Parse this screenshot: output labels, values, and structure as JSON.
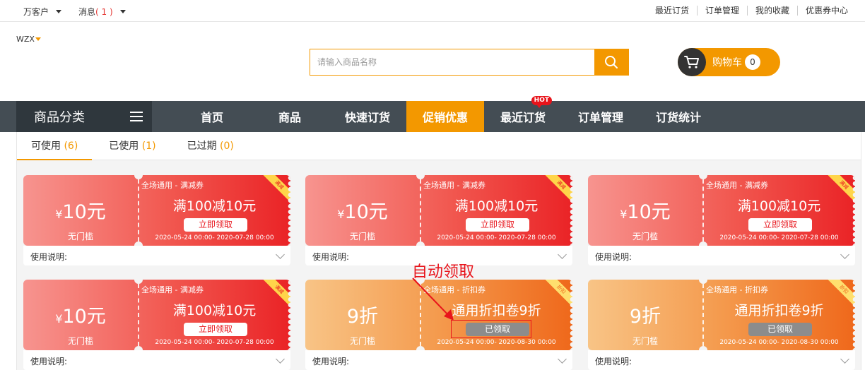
{
  "topbar": {
    "user": "万客户",
    "messages": "消息",
    "messages_count": "( 1 )",
    "links": [
      "最近订货",
      "订单管理",
      "我的收藏",
      "优惠券中心"
    ]
  },
  "header": {
    "logo": "WZX",
    "search_placeholder": "请输入商品名称",
    "cart_label": "购物车",
    "cart_count": "0"
  },
  "nav": {
    "category_label": "商品分类",
    "items": [
      "首页",
      "商品",
      "快速订货",
      "促销优惠",
      "最近订货",
      "订单管理",
      "订货统计"
    ],
    "active_index": 3,
    "hot_badge": "HOT"
  },
  "tabs": [
    {
      "label": "可使用",
      "count": "(6)"
    },
    {
      "label": "已使用",
      "count": "(1)"
    },
    {
      "label": "已过期",
      "count": "(0)"
    }
  ],
  "coupon_common": {
    "usage_label": "使用说明:"
  },
  "coupons": [
    {
      "style": "red",
      "currency": "¥",
      "value": "10元",
      "condition": "无门槛",
      "scope": "全场通用 - 满减券",
      "title": "满100减10元",
      "button": "立即领取",
      "taken": false,
      "dates": "2020-05-24 00:00- 2020-07-28 00:00",
      "ribbon": "满减"
    },
    {
      "style": "red",
      "currency": "¥",
      "value": "10元",
      "condition": "无门槛",
      "scope": "全场通用 - 满减券",
      "title": "满100减10元",
      "button": "立即领取",
      "taken": false,
      "dates": "2020-05-24 00:00- 2020-07-28 00:00",
      "ribbon": "满减"
    },
    {
      "style": "red",
      "currency": "¥",
      "value": "10元",
      "condition": "无门槛",
      "scope": "全场通用 - 满减券",
      "title": "满100减10元",
      "button": "立即领取",
      "taken": false,
      "dates": "2020-05-24 00:00- 2020-07-28 00:00",
      "ribbon": "满减"
    },
    {
      "style": "red",
      "currency": "¥",
      "value": "10元",
      "condition": "无门槛",
      "scope": "全场通用 - 满减券",
      "title": "满100减10元",
      "button": "立即领取",
      "taken": false,
      "dates": "2020-05-24 00:00- 2020-07-28 00:00",
      "ribbon": "满减"
    },
    {
      "style": "orange",
      "currency": "",
      "value": "9折",
      "condition": "无门槛",
      "scope": "全场通用 - 折扣券",
      "title": "通用折扣卷9折",
      "button": "已领取",
      "taken": true,
      "dates": "2020-05-24 00:00- 2020-08-30 00:00",
      "ribbon": "折扣"
    },
    {
      "style": "orange",
      "currency": "",
      "value": "9折",
      "condition": "无门槛",
      "scope": "全场通用 - 折扣券",
      "title": "通用折扣卷9折",
      "button": "已领取",
      "taken": true,
      "dates": "2020-05-24 00:00- 2020-08-30 00:00",
      "ribbon": "折扣"
    }
  ],
  "annotation": {
    "label": "自动领取",
    "color": "#e8141b"
  },
  "colors": {
    "accent": "#f39800",
    "nav_bg": "#444d54",
    "coupon_red": "#ea2326",
    "coupon_orange": "#ef681b"
  }
}
